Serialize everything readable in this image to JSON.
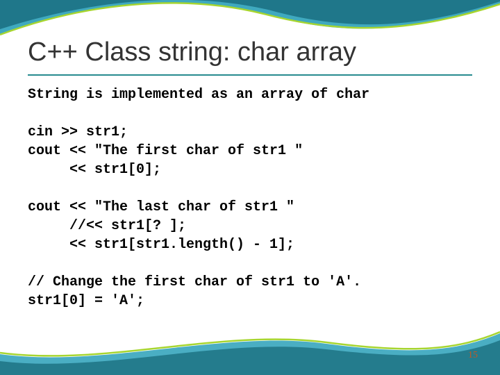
{
  "title": "C++ Class string: char array",
  "code_lines": [
    "String is implemented as an array of char",
    "",
    "cin >> str1;",
    "cout << \"The first char of str1 \"",
    "     << str1[0];",
    "",
    "cout << \"The last char of str1 \"",
    "     //<< str1[? ];",
    "     << str1[str1.length() - 1];",
    "",
    "// Change the first char of str1 to 'A'.",
    "str1[0] = 'A';"
  ],
  "page_number": "15"
}
